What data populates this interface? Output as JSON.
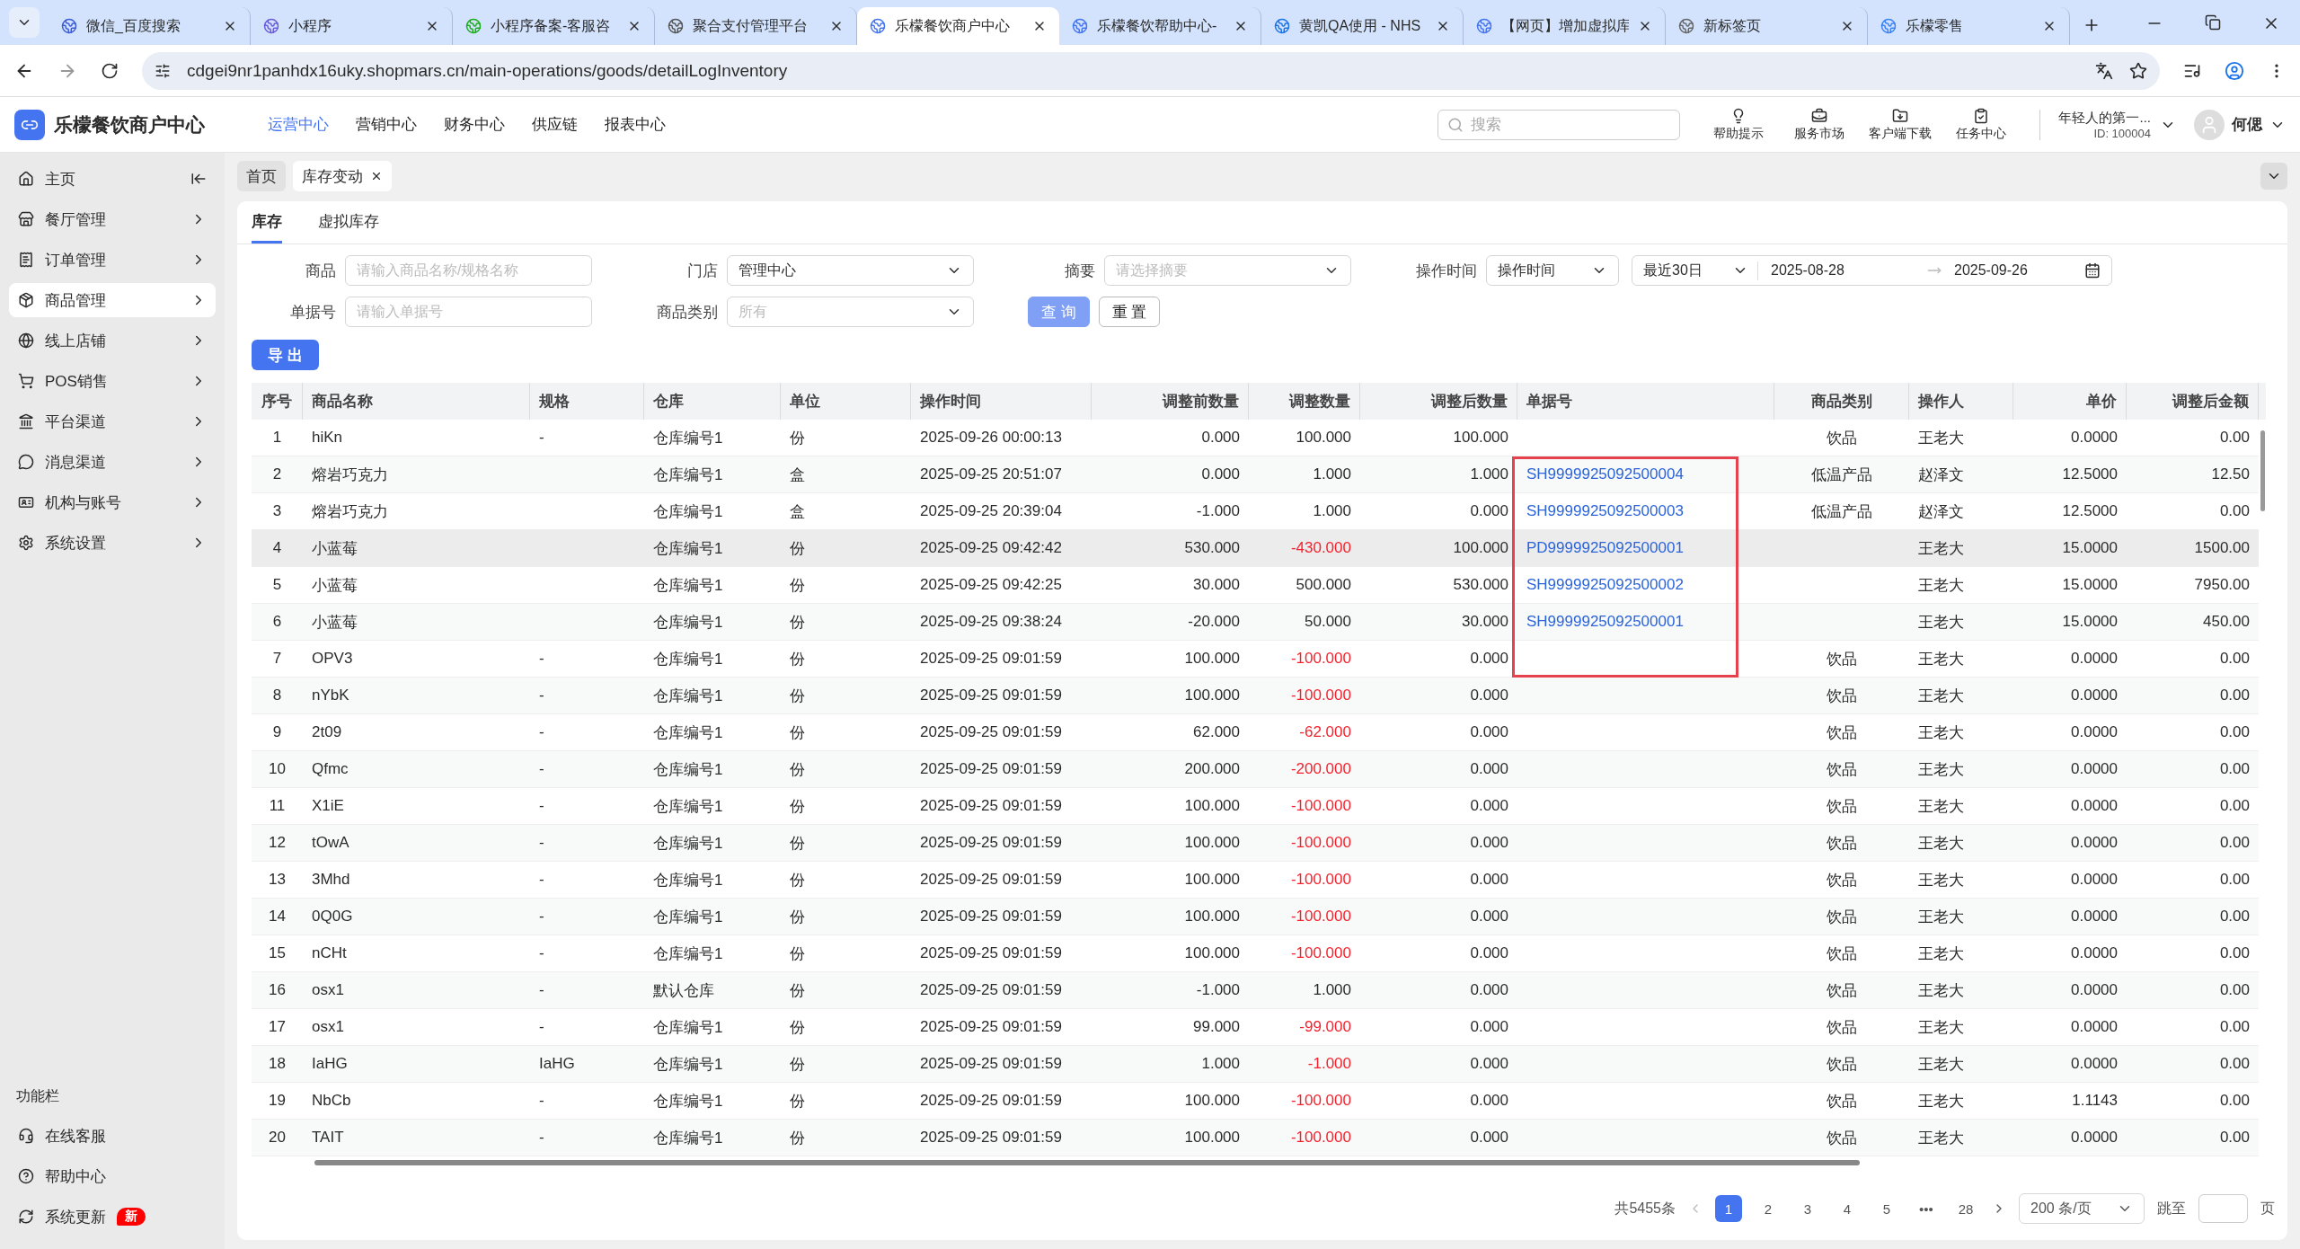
{
  "browser": {
    "tabs": [
      {
        "title": "微信_百度搜索",
        "selected": false
      },
      {
        "title": "小程序",
        "selected": false
      },
      {
        "title": "小程序备案-客服咨",
        "selected": false
      },
      {
        "title": "聚合支付管理平台",
        "selected": false
      },
      {
        "title": "乐檬餐饮商户中心",
        "selected": true
      },
      {
        "title": "乐檬餐饮帮助中心-",
        "selected": false
      },
      {
        "title": "黄凯QA使用 - NHS",
        "selected": false
      },
      {
        "title": "【网页】增加虚拟库",
        "selected": false
      },
      {
        "title": "新标签页",
        "selected": false
      },
      {
        "title": "乐檬零售",
        "selected": false
      }
    ],
    "url": "cdgei9nr1panhdx16uky.shopmars.cn/main-operations/goods/detailLogInventory"
  },
  "header": {
    "brand": "乐檬餐饮商户中心",
    "nav": [
      {
        "label": "运营中心",
        "selected": true
      },
      {
        "label": "营销中心",
        "selected": false
      },
      {
        "label": "财务中心",
        "selected": false
      },
      {
        "label": "供应链",
        "selected": false
      },
      {
        "label": "报表中心",
        "selected": false
      }
    ],
    "search_placeholder": "搜索",
    "tools": [
      "帮助提示",
      "服务市场",
      "客户端下载",
      "任务中心"
    ],
    "account": {
      "name": "年轻人的第一...",
      "id": "ID: 100004"
    },
    "user": "何偲"
  },
  "sidebar": {
    "items": [
      {
        "label": "主页",
        "selected": false,
        "expandable": false
      },
      {
        "label": "餐厅管理",
        "selected": false,
        "expandable": true
      },
      {
        "label": "订单管理",
        "selected": false,
        "expandable": true
      },
      {
        "label": "商品管理",
        "selected": true,
        "expandable": true
      },
      {
        "label": "线上店铺",
        "selected": false,
        "expandable": true
      },
      {
        "label": "POS销售",
        "selected": false,
        "expandable": true
      },
      {
        "label": "平台渠道",
        "selected": false,
        "expandable": true
      },
      {
        "label": "消息渠道",
        "selected": false,
        "expandable": true
      },
      {
        "label": "机构与账号",
        "selected": false,
        "expandable": true
      },
      {
        "label": "系统设置",
        "selected": false,
        "expandable": true
      }
    ],
    "footer_title": "功能栏",
    "footer_items": [
      {
        "label": "在线客服"
      },
      {
        "label": "帮助中心"
      },
      {
        "label": "系统更新",
        "badge": "新"
      }
    ]
  },
  "page_tabs": [
    {
      "label": "首页",
      "selected": false,
      "closable": false
    },
    {
      "label": "库存变动",
      "selected": true,
      "closable": true
    }
  ],
  "sub_tabs": [
    {
      "label": "库存",
      "selected": true
    },
    {
      "label": "虚拟库存",
      "selected": false
    }
  ],
  "filters": {
    "product": {
      "label": "商品",
      "placeholder": "请输入商品名称/规格名称"
    },
    "store": {
      "label": "门店",
      "value": "管理中心"
    },
    "summary": {
      "label": "摘要",
      "placeholder": "请选择摘要"
    },
    "time": {
      "label": "操作时间",
      "type_value": "操作时间",
      "range_value": "最近30日",
      "start": "2025-08-28",
      "end": "2025-09-26"
    },
    "doc_no": {
      "label": "单据号",
      "placeholder": "请输入单据号"
    },
    "category": {
      "label": "商品类别",
      "placeholder": "所有"
    },
    "search_button": "查 询",
    "reset_button": "重 置"
  },
  "export_button": "导 出",
  "table": {
    "columns": [
      "序号",
      "商品名称",
      "规格",
      "仓库",
      "单位",
      "操作时间",
      "调整前数量",
      "调整数量",
      "调整后数量",
      "单据号",
      "商品类别",
      "操作人",
      "单价",
      "调整后金额"
    ],
    "rows": [
      {
        "no": "1",
        "name": "hiKn",
        "spec": "-",
        "warehouse": "仓库编号1",
        "unit": "份",
        "time": "2025-09-26 00:00:13",
        "before": "0.000",
        "change": "100.000",
        "change_negative": false,
        "after": "100.000",
        "category": "饮品",
        "operator": "王老大",
        "price": "0.0000",
        "amount": "0.00",
        "highlighted": false
      },
      {
        "no": "2",
        "name": "熔岩巧克力",
        "warehouse": "仓库编号1",
        "unit": "盒",
        "time": "2025-09-25 20:51:07",
        "before": "0.000",
        "change": "1.000",
        "change_negative": false,
        "after": "1.000",
        "doc": "SH9999925092500004",
        "category": "低温产品",
        "operator": "赵泽文",
        "price": "12.5000",
        "amount": "12.50",
        "highlighted": false
      },
      {
        "no": "3",
        "name": "熔岩巧克力",
        "warehouse": "仓库编号1",
        "unit": "盒",
        "time": "2025-09-25 20:39:04",
        "before": "-1.000",
        "change": "1.000",
        "change_negative": false,
        "after": "0.000",
        "doc": "SH9999925092500003",
        "category": "低温产品",
        "operator": "赵泽文",
        "price": "12.5000",
        "amount": "0.00",
        "highlighted": false
      },
      {
        "no": "4",
        "name": "小蓝莓",
        "warehouse": "仓库编号1",
        "unit": "份",
        "time": "2025-09-25 09:42:42",
        "before": "530.000",
        "change": "-430.000",
        "change_negative": true,
        "after": "100.000",
        "doc": "PD9999925092500001",
        "operator": "王老大",
        "price": "15.0000",
        "amount": "1500.00",
        "highlighted": true
      },
      {
        "no": "5",
        "name": "小蓝莓",
        "warehouse": "仓库编号1",
        "unit": "份",
        "time": "2025-09-25 09:42:25",
        "before": "30.000",
        "change": "500.000",
        "change_negative": false,
        "after": "530.000",
        "doc": "SH9999925092500002",
        "operator": "王老大",
        "price": "15.0000",
        "amount": "7950.00",
        "highlighted": false
      },
      {
        "no": "6",
        "name": "小蓝莓",
        "warehouse": "仓库编号1",
        "unit": "份",
        "time": "2025-09-25 09:38:24",
        "before": "-20.000",
        "change": "50.000",
        "change_negative": false,
        "after": "30.000",
        "doc": "SH9999925092500001",
        "operator": "王老大",
        "price": "15.0000",
        "amount": "450.00",
        "highlighted": false
      },
      {
        "no": "7",
        "name": "OPV3",
        "spec": "-",
        "warehouse": "仓库编号1",
        "unit": "份",
        "time": "2025-09-25 09:01:59",
        "before": "100.000",
        "change": "-100.000",
        "change_negative": true,
        "after": "0.000",
        "category": "饮品",
        "operator": "王老大",
        "price": "0.0000",
        "amount": "0.00",
        "highlighted": false
      },
      {
        "no": "8",
        "name": "nYbK",
        "spec": "-",
        "warehouse": "仓库编号1",
        "unit": "份",
        "time": "2025-09-25 09:01:59",
        "before": "100.000",
        "change": "-100.000",
        "change_negative": true,
        "after": "0.000",
        "category": "饮品",
        "operator": "王老大",
        "price": "0.0000",
        "amount": "0.00",
        "highlighted": false
      },
      {
        "no": "9",
        "name": "2t09",
        "spec": "-",
        "warehouse": "仓库编号1",
        "unit": "份",
        "time": "2025-09-25 09:01:59",
        "before": "62.000",
        "change": "-62.000",
        "change_negative": true,
        "after": "0.000",
        "category": "饮品",
        "operator": "王老大",
        "price": "0.0000",
        "amount": "0.00",
        "highlighted": false
      },
      {
        "no": "10",
        "name": "Qfmc",
        "spec": "-",
        "warehouse": "仓库编号1",
        "unit": "份",
        "time": "2025-09-25 09:01:59",
        "before": "200.000",
        "change": "-200.000",
        "change_negative": true,
        "after": "0.000",
        "category": "饮品",
        "operator": "王老大",
        "price": "0.0000",
        "amount": "0.00",
        "highlighted": false
      },
      {
        "no": "11",
        "name": "X1iE",
        "spec": "-",
        "warehouse": "仓库编号1",
        "unit": "份",
        "time": "2025-09-25 09:01:59",
        "before": "100.000",
        "change": "-100.000",
        "change_negative": true,
        "after": "0.000",
        "category": "饮品",
        "operator": "王老大",
        "price": "0.0000",
        "amount": "0.00",
        "highlighted": false
      },
      {
        "no": "12",
        "name": "tOwA",
        "spec": "-",
        "warehouse": "仓库编号1",
        "unit": "份",
        "time": "2025-09-25 09:01:59",
        "before": "100.000",
        "change": "-100.000",
        "change_negative": true,
        "after": "0.000",
        "category": "饮品",
        "operator": "王老大",
        "price": "0.0000",
        "amount": "0.00",
        "highlighted": false
      },
      {
        "no": "13",
        "name": "3Mhd",
        "spec": "-",
        "warehouse": "仓库编号1",
        "unit": "份",
        "time": "2025-09-25 09:01:59",
        "before": "100.000",
        "change": "-100.000",
        "change_negative": true,
        "after": "0.000",
        "category": "饮品",
        "operator": "王老大",
        "price": "0.0000",
        "amount": "0.00",
        "highlighted": false
      },
      {
        "no": "14",
        "name": "0Q0G",
        "spec": "-",
        "warehouse": "仓库编号1",
        "unit": "份",
        "time": "2025-09-25 09:01:59",
        "before": "100.000",
        "change": "-100.000",
        "change_negative": true,
        "after": "0.000",
        "category": "饮品",
        "operator": "王老大",
        "price": "0.0000",
        "amount": "0.00",
        "highlighted": false
      },
      {
        "no": "15",
        "name": "nCHt",
        "spec": "-",
        "warehouse": "仓库编号1",
        "unit": "份",
        "time": "2025-09-25 09:01:59",
        "before": "100.000",
        "change": "-100.000",
        "change_negative": true,
        "after": "0.000",
        "category": "饮品",
        "operator": "王老大",
        "price": "0.0000",
        "amount": "0.00",
        "highlighted": false
      },
      {
        "no": "16",
        "name": "osx1",
        "spec": "-",
        "warehouse": "默认仓库",
        "unit": "份",
        "time": "2025-09-25 09:01:59",
        "before": "-1.000",
        "change": "1.000",
        "change_negative": false,
        "after": "0.000",
        "category": "饮品",
        "operator": "王老大",
        "price": "0.0000",
        "amount": "0.00",
        "highlighted": false
      },
      {
        "no": "17",
        "name": "osx1",
        "spec": "-",
        "warehouse": "仓库编号1",
        "unit": "份",
        "time": "2025-09-25 09:01:59",
        "before": "99.000",
        "change": "-99.000",
        "change_negative": true,
        "after": "0.000",
        "category": "饮品",
        "operator": "王老大",
        "price": "0.0000",
        "amount": "0.00",
        "highlighted": false
      },
      {
        "no": "18",
        "name": "IaHG",
        "spec": "IaHG",
        "warehouse": "仓库编号1",
        "unit": "份",
        "time": "2025-09-25 09:01:59",
        "before": "1.000",
        "change": "-1.000",
        "change_negative": true,
        "after": "0.000",
        "category": "饮品",
        "operator": "王老大",
        "price": "0.0000",
        "amount": "0.00",
        "highlighted": false
      },
      {
        "no": "19",
        "name": "NbCb",
        "spec": "-",
        "warehouse": "仓库编号1",
        "unit": "份",
        "time": "2025-09-25 09:01:59",
        "before": "100.000",
        "change": "-100.000",
        "change_negative": true,
        "after": "0.000",
        "category": "饮品",
        "operator": "王老大",
        "price": "1.1143",
        "amount": "0.00",
        "highlighted": false
      },
      {
        "no": "20",
        "name": "TAIT",
        "spec": "-",
        "warehouse": "仓库编号1",
        "unit": "份",
        "time": "2025-09-25 09:01:59",
        "before": "100.000",
        "change": "-100.000",
        "change_negative": true,
        "after": "0.000",
        "category": "饮品",
        "operator": "王老大",
        "price": "0.0000",
        "amount": "0.00",
        "highlighted": false
      }
    ]
  },
  "pagination": {
    "total": "共5455条",
    "pages": [
      {
        "label": "1",
        "selected": true
      },
      {
        "label": "2",
        "selected": false
      },
      {
        "label": "3",
        "selected": false
      },
      {
        "label": "4",
        "selected": false
      },
      {
        "label": "5",
        "selected": false
      },
      {
        "label": "•••",
        "selected": false
      },
      {
        "label": "28",
        "selected": false
      }
    ],
    "page_size": "200 条/页",
    "jump_label": "跳至",
    "page_unit": "页"
  }
}
